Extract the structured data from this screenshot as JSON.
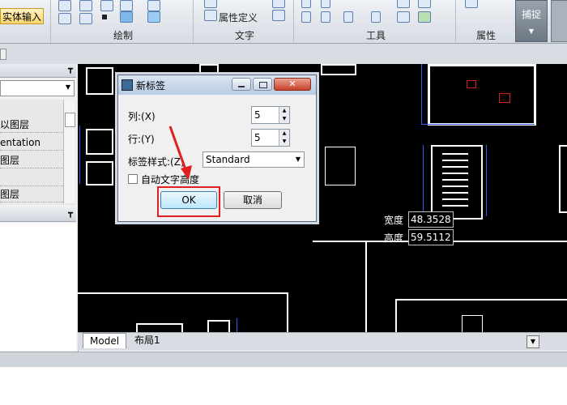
{
  "ribbon": {
    "solid_input_label": "实体输入",
    "groups": {
      "draw": "绘制",
      "text": "文字",
      "tools": "工具",
      "props": "属性"
    },
    "attr_def_label": "属性定义",
    "snap_label": "捕捉"
  },
  "left_panel": {
    "layer_items": [
      "以图层",
      "entation",
      "图层",
      "",
      "图层"
    ]
  },
  "dialog": {
    "title": "新标签",
    "col_label": "列:(X)",
    "row_label": "行:(Y)",
    "col_value": "5",
    "row_value": "5",
    "style_label": "标签样式:(Z)",
    "style_value": "Standard",
    "auto_height_label": "自动文字高度",
    "ok_label": "OK",
    "cancel_label": "取消"
  },
  "canvas": {
    "width_label": "宽度",
    "width_value": "48.3528",
    "height_label": "高度",
    "height_value": "59.5112"
  },
  "tabs": [
    "Model",
    "布局1"
  ],
  "colors": {
    "highlight": "#e02020",
    "cad_background": "#000000",
    "cad_blue": "#2f5cff"
  }
}
